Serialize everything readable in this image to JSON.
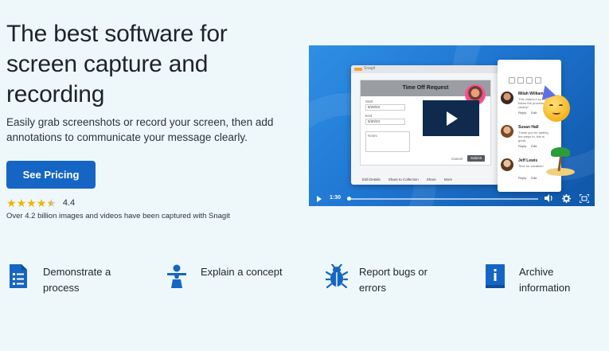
{
  "hero": {
    "title": "The best software for screen capture and recording",
    "subtitle": "Easily grab screenshots or record your screen, then add annotations to communicate your message clearly.",
    "cta_label": "See Pricing",
    "rating": {
      "value": 4.4,
      "value_label": "4.4",
      "max": 5
    },
    "rating_note": "Over 4.2 billion images and videos have been captured with Snagit"
  },
  "video": {
    "app_name": "Snagit",
    "form": {
      "title": "Time Off Request",
      "start_label": "Start",
      "start_value": "8/29/23",
      "end_label": "End",
      "end_value": "8/30/23",
      "notes_placeholder": "Notes",
      "cancel_label": "Cancel",
      "submit_label": "Submit"
    },
    "toolbar": [
      "Edit Details",
      "Share to Collection",
      "Share",
      "More"
    ],
    "comments": [
      {
        "name": "Milah Williams",
        "text": "This makes it so easy to follow the process so clearly!",
        "reply": "Reply",
        "edit": "Edit"
      },
      {
        "name": "Susan Hall",
        "text": "Thank you for adding the steps in, this is great.",
        "reply": "Reply",
        "edit": "Edit"
      },
      {
        "name": "Jeff Lewis",
        "text": "Time for vacation!",
        "reply": "Reply",
        "edit": "Edit"
      }
    ],
    "time": "1:30",
    "progress": 0.01,
    "icons": {
      "play": "play-icon",
      "volume": "volume-icon",
      "settings": "gear-icon",
      "fullscreen": "fullscreen-icon"
    }
  },
  "features": [
    {
      "label": "Demonstrate a process",
      "icon": "document-list-icon"
    },
    {
      "label": "Explain a concept",
      "icon": "presenter-icon"
    },
    {
      "label": "Report bugs or errors",
      "icon": "bug-icon"
    },
    {
      "label": "Archive information",
      "icon": "info-book-icon"
    }
  ],
  "colors": {
    "background": "#eef8fb",
    "accent": "#1566c4",
    "star": "#f3b200",
    "icon": "#1566c4"
  }
}
